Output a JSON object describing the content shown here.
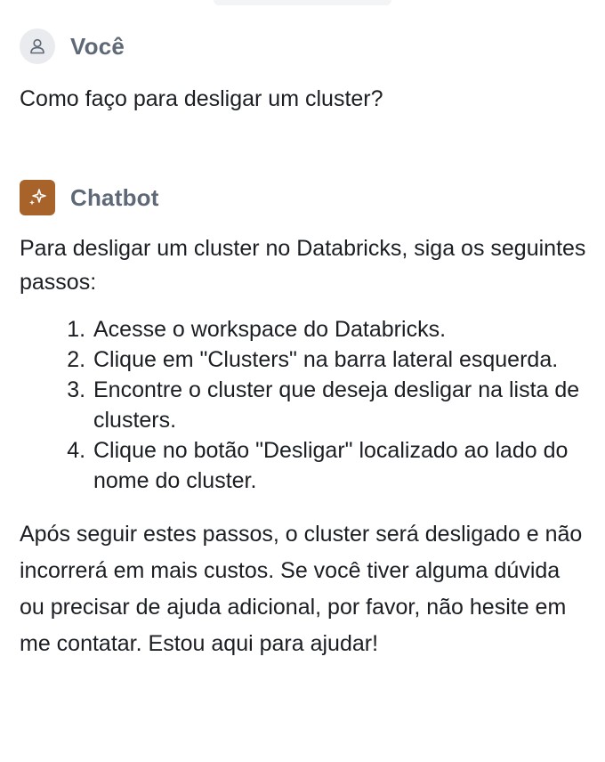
{
  "user_message": {
    "author": "Você",
    "avatar_icon": "user-icon",
    "text": "Como faço para desligar um cluster?"
  },
  "bot_message": {
    "author": "Chatbot",
    "avatar_icon": "sparkle-icon",
    "avatar_color": "#a8632a",
    "intro": "Para desligar um cluster no Databricks, siga os seguintes passos:",
    "steps": [
      "Acesse o workspace do Databricks.",
      "Clique em \"Clusters\" na barra lateral esquerda.",
      "Encontre o cluster que deseja desligar na lista de clusters.",
      "Clique no botão \"Desligar\" localizado ao lado do nome do cluster."
    ],
    "outro": "Após seguir estes passos, o cluster será desligado e não incorrerá em mais custos. Se você tiver alguma dúvida ou precisar de ajuda adicional, por favor, não hesite em me contatar. Estou aqui para ajudar!"
  }
}
